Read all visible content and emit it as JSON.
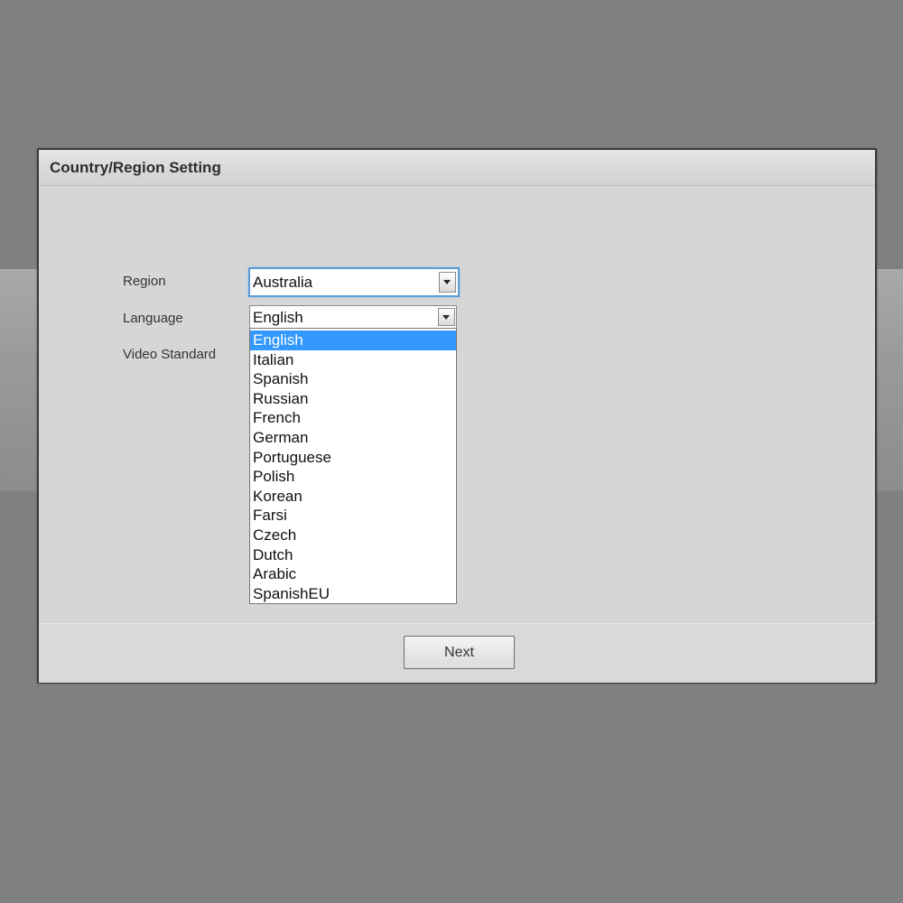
{
  "dialog": {
    "title": "Country/Region Setting"
  },
  "form": {
    "region_label": "Region",
    "region_value": "Australia",
    "language_label": "Language",
    "language_value": "English",
    "video_standard_label": "Video Standard"
  },
  "language_dropdown": {
    "selected": "English",
    "options": [
      "English",
      "Italian",
      "Spanish",
      "Russian",
      "French",
      "German",
      "Portuguese",
      "Polish",
      "Korean",
      "Farsi",
      "Czech",
      "Dutch",
      "Arabic",
      "SpanishEU"
    ]
  },
  "footer": {
    "next_label": "Next"
  },
  "icons": {
    "select_arrow": "chevron-down-icon"
  },
  "colors": {
    "highlight": "#3399ff",
    "focus_border": "#5b9bd5",
    "backdrop": "#808080"
  }
}
